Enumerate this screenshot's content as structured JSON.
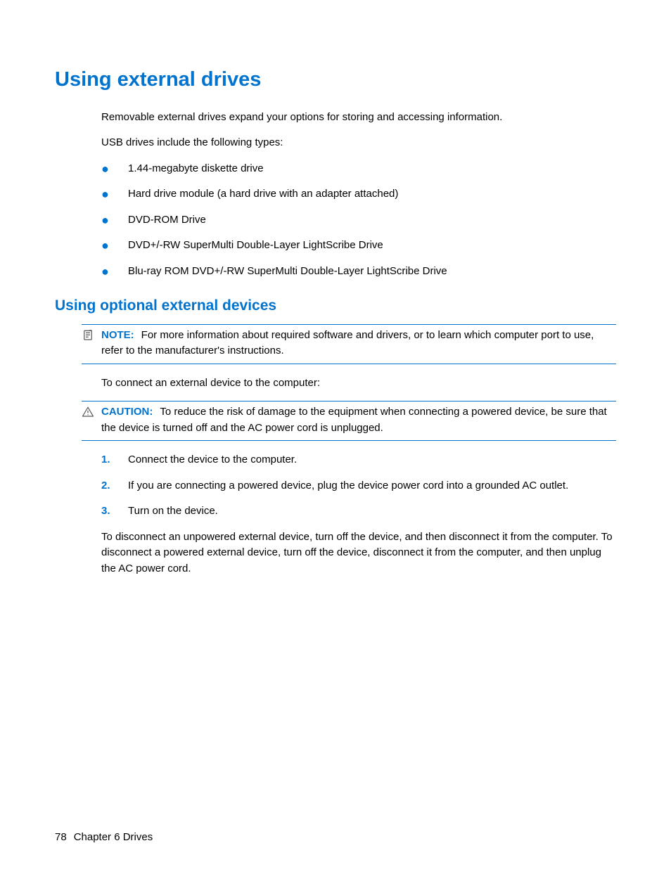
{
  "heading1": "Using external drives",
  "intro1": "Removable external drives expand your options for storing and accessing information.",
  "intro2": "USB drives include the following types:",
  "bullets": [
    "1.44-megabyte diskette drive",
    "Hard drive module (a hard drive with an adapter attached)",
    "DVD-ROM Drive",
    "DVD+/-RW SuperMulti Double-Layer LightScribe Drive",
    "Blu-ray ROM DVD+/-RW SuperMulti Double-Layer LightScribe Drive"
  ],
  "heading2": "Using optional external devices",
  "note": {
    "label": "NOTE:",
    "text": "For more information about required software and drivers, or to learn which computer port to use, refer to the manufacturer's instructions."
  },
  "connectIntro": "To connect an external device to the computer:",
  "caution": {
    "label": "CAUTION:",
    "text": "To reduce the risk of damage to the equipment when connecting a powered device, be sure that the device is turned off and the AC power cord is unplugged."
  },
  "steps": [
    {
      "num": "1.",
      "text": "Connect the device to the computer."
    },
    {
      "num": "2.",
      "text": "If you are connecting a powered device, plug the device power cord into a grounded AC outlet."
    },
    {
      "num": "3.",
      "text": "Turn on the device."
    }
  ],
  "disconnect": "To disconnect an unpowered external device, turn off the device, and then disconnect it from the computer. To disconnect a powered external device, turn off the device, disconnect it from the computer, and then unplug the AC power cord.",
  "footer": {
    "page": "78",
    "chapter": "Chapter 6   Drives"
  }
}
